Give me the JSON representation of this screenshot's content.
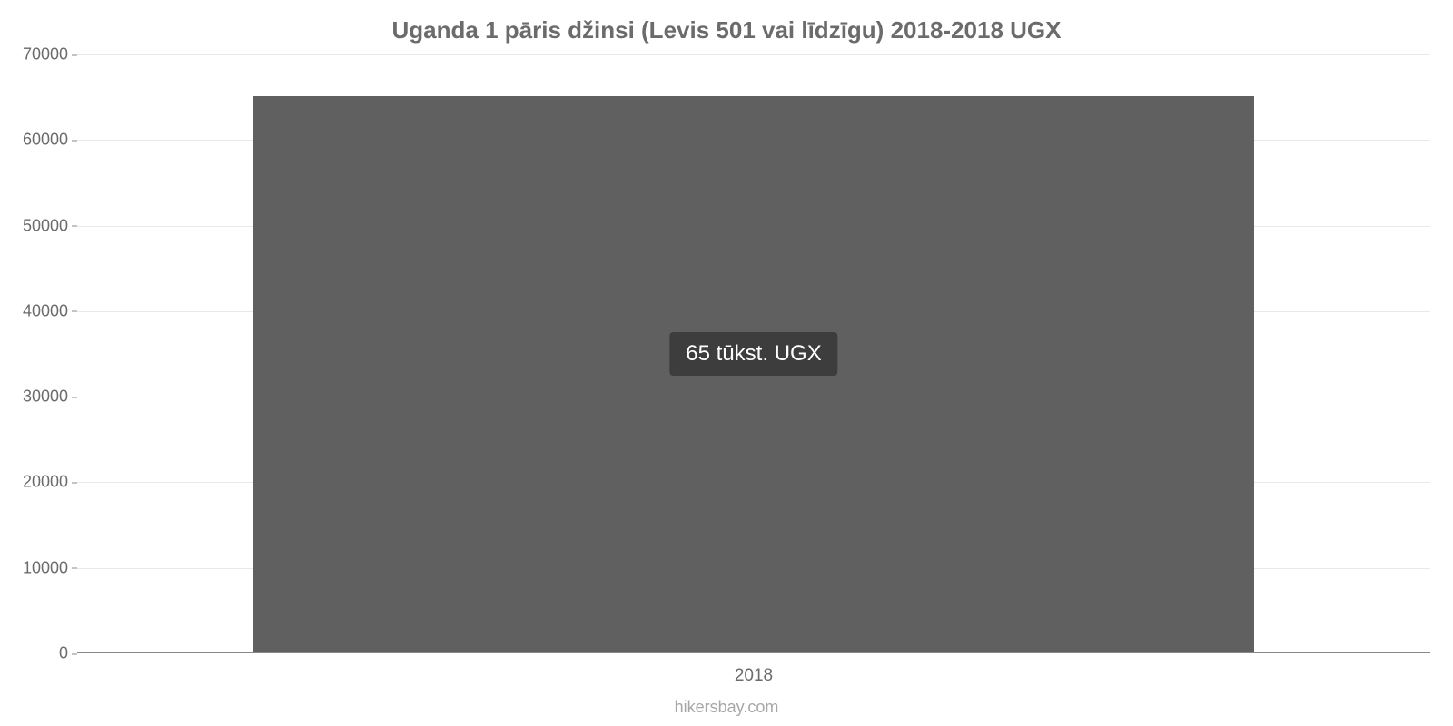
{
  "chart_data": {
    "type": "bar",
    "title": "Uganda 1 pāris džinsi (Levis 501 vai līdzīgu) 2018-2018 UGX",
    "categories": [
      "2018"
    ],
    "values": [
      65000
    ],
    "value_labels": [
      "65 tūkst. UGX"
    ],
    "xlabel": "",
    "ylabel": "",
    "ylim": [
      0,
      70000
    ],
    "y_ticks": [
      0,
      10000,
      20000,
      30000,
      40000,
      50000,
      60000,
      70000
    ],
    "bar_color": "#606060",
    "source": "hikersbay.com"
  }
}
